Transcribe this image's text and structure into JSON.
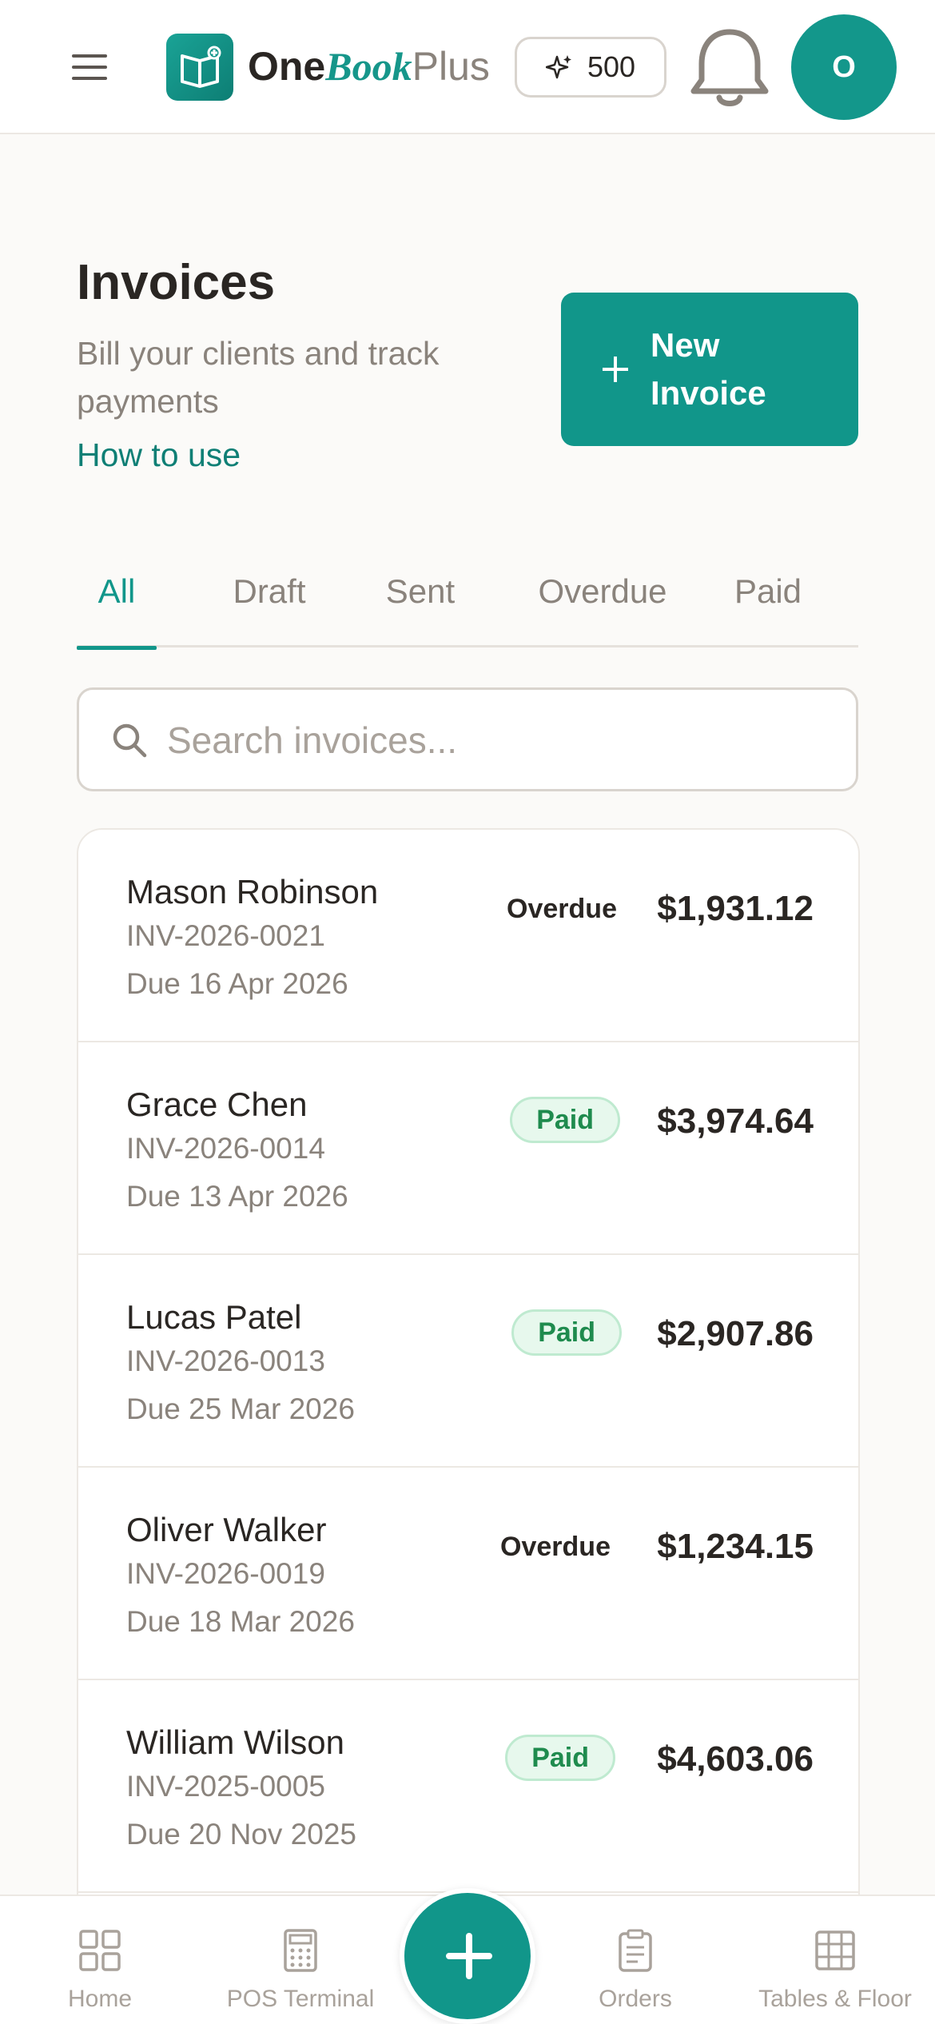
{
  "header": {
    "brand": {
      "one": "One",
      "book": "Book",
      "plus": "Plus"
    },
    "credits": "500",
    "avatar_initial": "O",
    "icons": {
      "menu": "hamburger-icon",
      "logo": "open-book-icon",
      "credits": "sparkle-icon",
      "notifications": "bell-icon"
    }
  },
  "page": {
    "title": "Invoices",
    "subtitle": "Bill your clients and track payments",
    "how_to": "How to use",
    "new_invoice": "New Invoice"
  },
  "tabs": [
    "All",
    "Draft",
    "Sent",
    "Overdue",
    "Paid"
  ],
  "active_tab": "All",
  "search": {
    "placeholder": "Search invoices...",
    "value": ""
  },
  "invoices": [
    {
      "client": "Mason Robinson",
      "number": "INV-2026-0021",
      "due": "Due 16 Apr 2026",
      "status": "Overdue",
      "amount": "$1,931.12"
    },
    {
      "client": "Grace Chen",
      "number": "INV-2026-0014",
      "due": "Due 13 Apr 2026",
      "status": "Paid",
      "amount": "$3,974.64"
    },
    {
      "client": "Lucas Patel",
      "number": "INV-2026-0013",
      "due": "Due 25 Mar 2026",
      "status": "Paid",
      "amount": "$2,907.86"
    },
    {
      "client": "Oliver Walker",
      "number": "INV-2026-0019",
      "due": "Due 18 Mar 2026",
      "status": "Overdue",
      "amount": "$1,234.15"
    },
    {
      "client": "William Wilson",
      "number": "INV-2025-0005",
      "due": "Due 20 Nov 2025",
      "status": "Paid",
      "amount": "$4,603.06"
    }
  ],
  "bottom_nav": [
    {
      "label": "Home",
      "icon": "grid-icon"
    },
    {
      "label": "POS Terminal",
      "icon": "calculator-icon"
    },
    {
      "label": "Orders",
      "icon": "clipboard-icon"
    },
    {
      "label": "Tables & Floor",
      "icon": "table-grid-icon"
    }
  ],
  "colors": {
    "accent": "#11968a",
    "paid_text": "#1f8b4e",
    "paid_bg": "#e7f8ed",
    "muted": "#8a837c"
  }
}
